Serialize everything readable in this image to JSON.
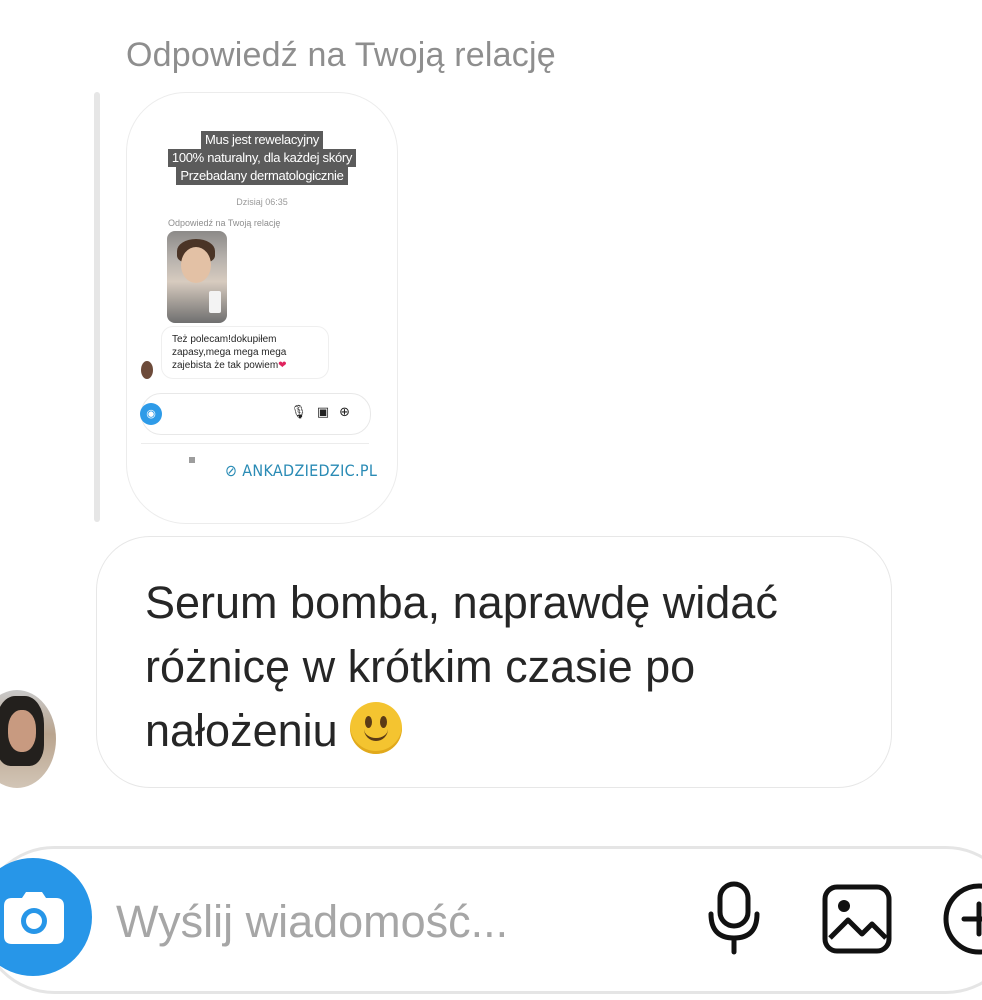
{
  "reply_label": "Odpowiedź na Twoją relację",
  "story_preview": {
    "overlay_lines": [
      "Mus jest rewelacyjny",
      "100% naturalny, dla każdej skóry",
      "Przebadany dermatologicznie"
    ],
    "timestamp": "Dzisiaj 06:35",
    "reply_label": "Odpowiedź na Twoją relację",
    "message_text": "Też polecam!dokupiłem zapasy,mega mega mega zajebista że tak powiem",
    "message_heart": "❤",
    "link": "ANKADZIEDZIC.PL"
  },
  "message": {
    "text": "Serum bomba, naprawdę widać różnicę w krótkim czasie po nałożeniu"
  },
  "composer": {
    "placeholder": "Wyślij wiadomość..."
  },
  "colors": {
    "accent": "#2796e8",
    "link": "#2a8bb5",
    "muted": "#8e8e8e"
  },
  "icons": [
    "camera-icon",
    "microphone-icon",
    "image-icon",
    "plus-icon",
    "smiley-emoji",
    "link-icon"
  ]
}
